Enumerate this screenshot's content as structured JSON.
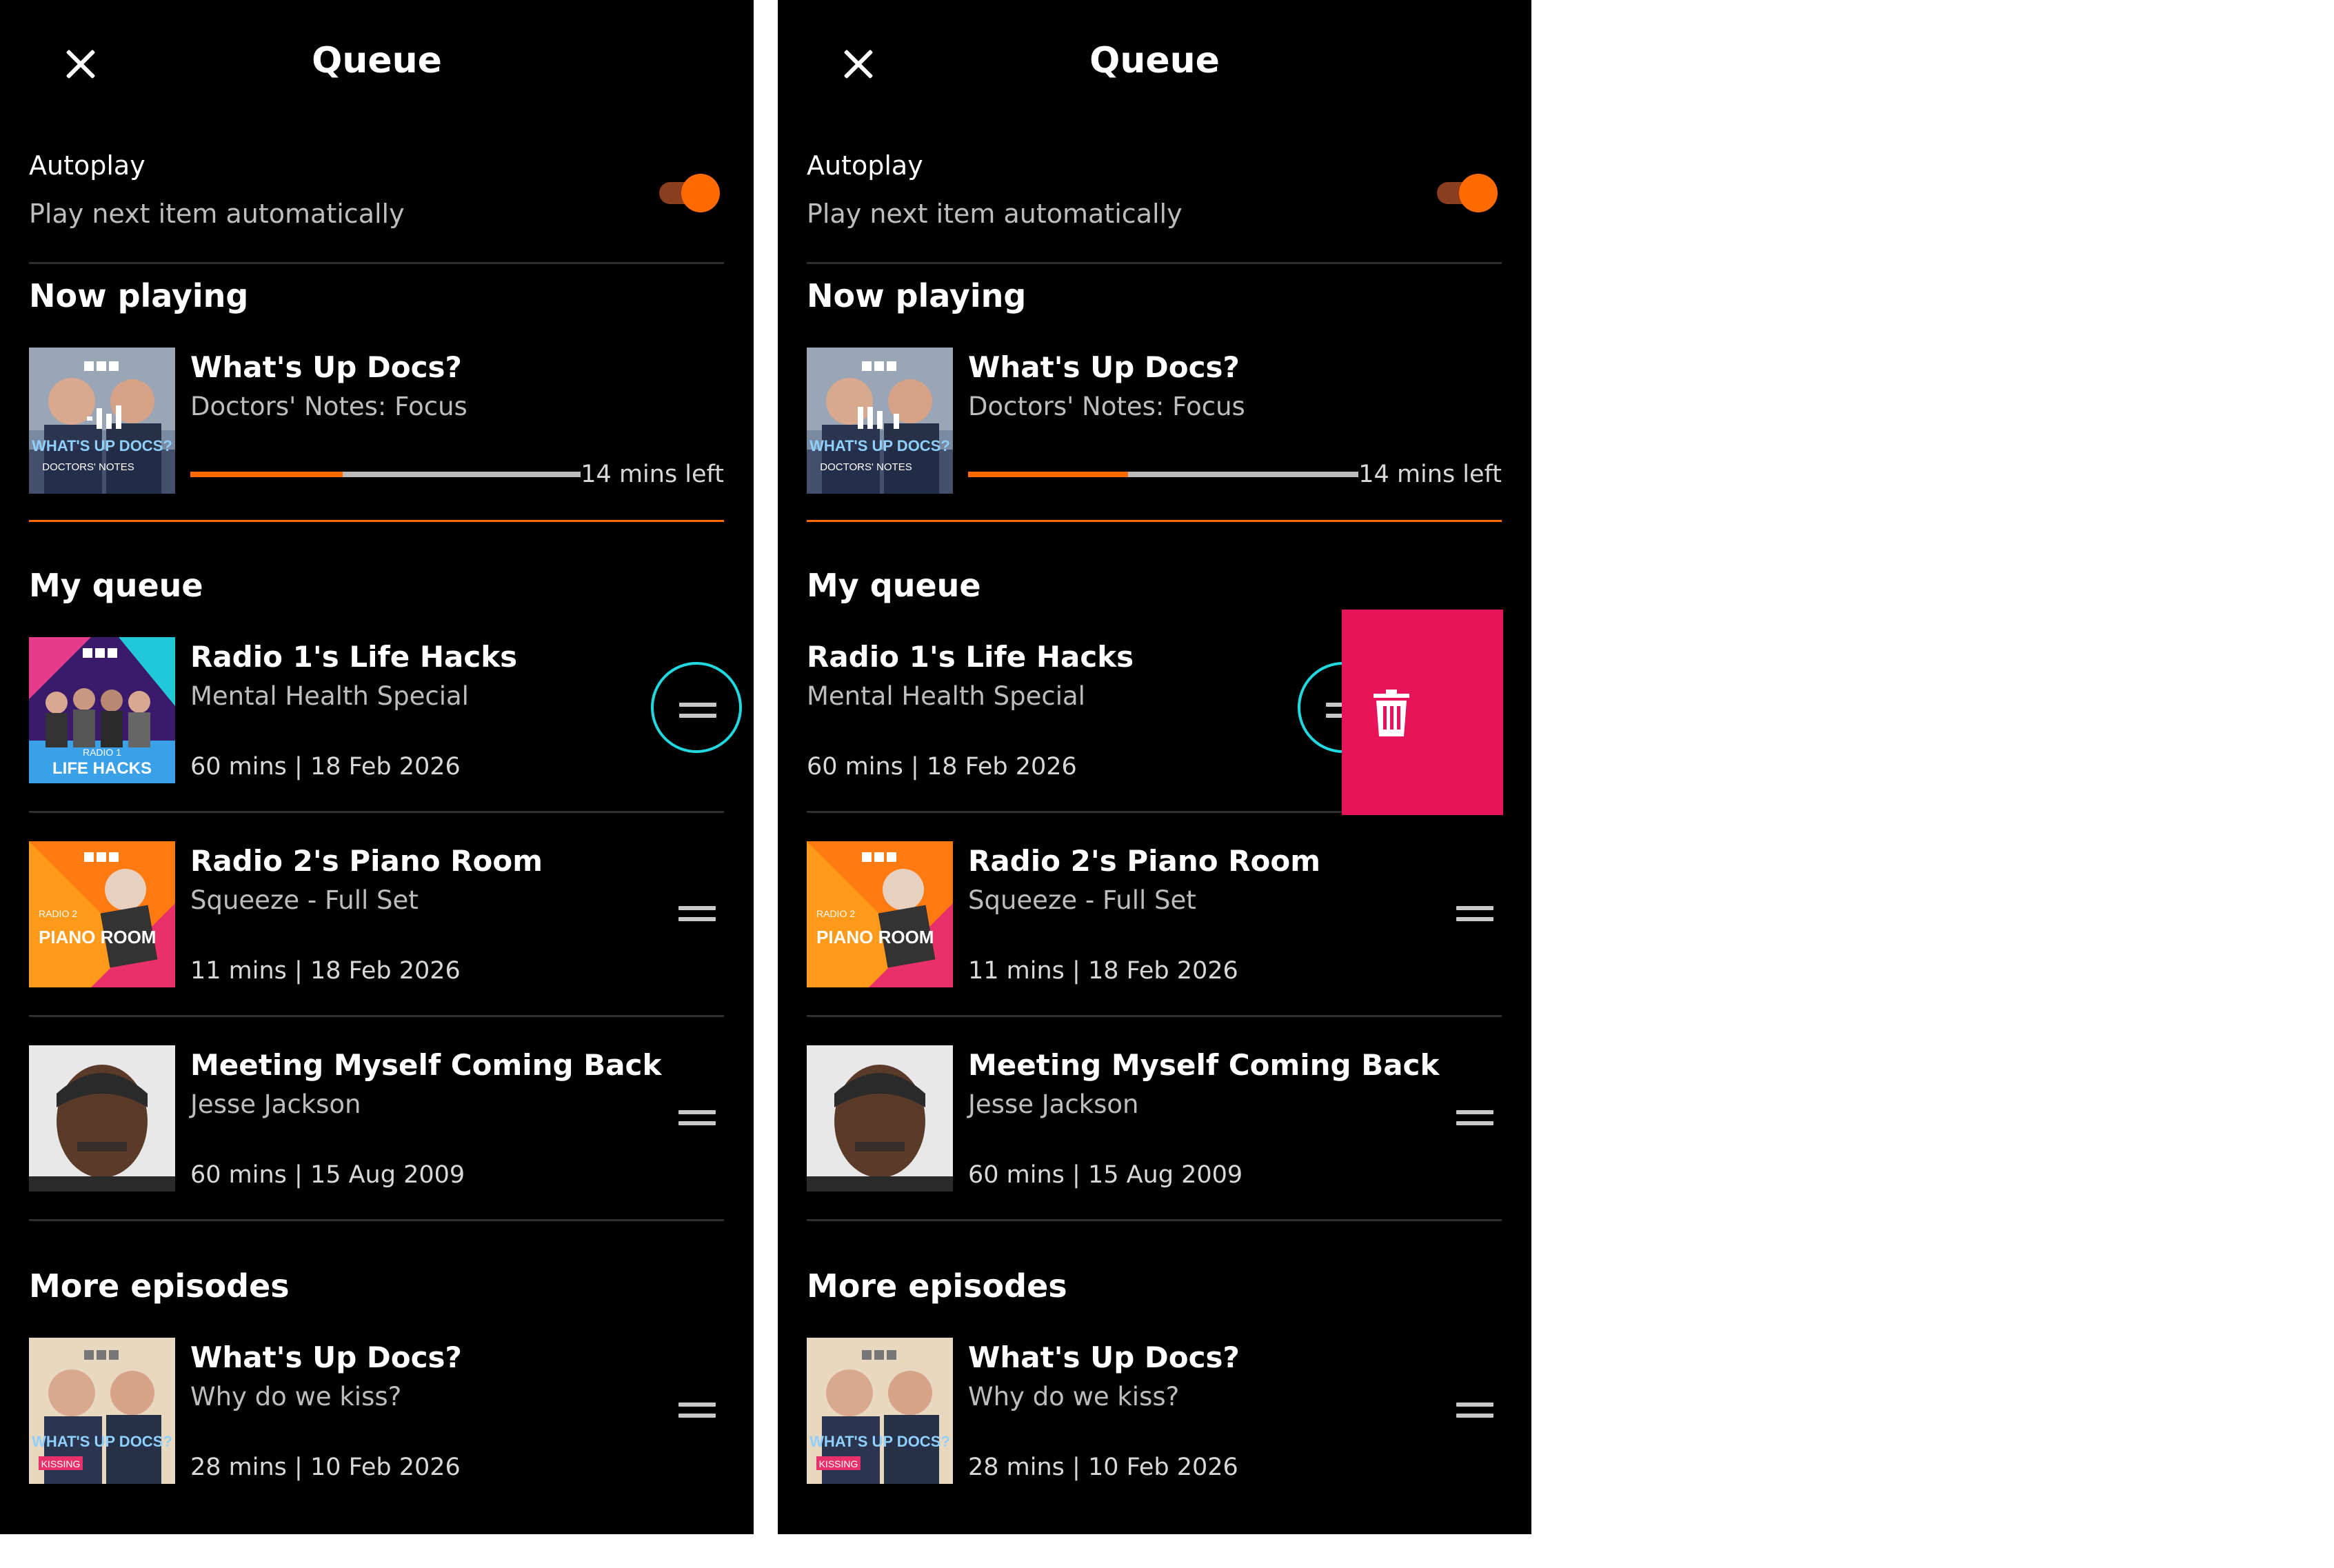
{
  "colors": {
    "accent": "#ff6a00",
    "focus_ring": "#20d8e0",
    "delete": "#e8145a",
    "background": "#000000"
  },
  "icons": {
    "close": "close-icon",
    "drag": "drag-handle-icon",
    "delete": "trash-icon",
    "playing": "equalizer-icon"
  },
  "panels": [
    {
      "title": "Queue",
      "autoplay": {
        "label": "Autoplay",
        "description": "Play next item automatically",
        "enabled": true
      },
      "now_playing": {
        "heading": "Now playing",
        "title": "What's Up Docs?",
        "subtitle": "Doctors' Notes: Focus",
        "thumb_text": "WHAT'S UP DOCS?",
        "thumb_sub": "DOCTORS' NOTES",
        "time_left": "14 mins left",
        "progress": 0.39
      },
      "my_queue": {
        "heading": "My queue",
        "items": [
          {
            "title": "Radio 1's Life Hacks",
            "subtitle": "Mental Health Special",
            "meta": "60 mins | 18 Feb 2026",
            "thumb_text": "LIFE HACKS",
            "thumb_sub": "RADIO 1"
          },
          {
            "title": "Radio 2's Piano Room",
            "subtitle": "Squeeze - Full Set",
            "meta": "11 mins | 18 Feb 2026",
            "thumb_text": "PIANO ROOM",
            "thumb_sub": "RADIO 2"
          },
          {
            "title": "Meeting Myself Coming Back",
            "subtitle": "Jesse Jackson",
            "meta": "60 mins | 15 Aug 2009"
          }
        ]
      },
      "more_episodes": {
        "heading": "More episodes",
        "items": [
          {
            "title": "What's Up Docs?",
            "subtitle": "Why do we kiss?",
            "meta": "28 mins | 10 Feb 2026",
            "thumb_text": "WHAT'S UP DOCS?",
            "thumb_sub": "KISSING"
          }
        ]
      }
    },
    {
      "title": "Queue",
      "autoplay": {
        "label": "Autoplay",
        "description": "Play next item automatically",
        "enabled": true
      },
      "now_playing": {
        "heading": "Now playing",
        "title": "What's Up Docs?",
        "subtitle": "Doctors' Notes: Focus",
        "thumb_text": "WHAT'S UP DOCS?",
        "thumb_sub": "DOCTORS' NOTES",
        "time_left": "14 mins left",
        "progress": 0.41
      },
      "my_queue": {
        "heading": "My queue",
        "items": [
          {
            "title": "Radio 1's Life Hacks",
            "subtitle": "Mental Health Special",
            "meta": "60 mins | 18 Feb 2026"
          },
          {
            "title": "Radio 2's Piano Room",
            "subtitle": "Squeeze - Full Set",
            "meta": "11 mins | 18 Feb 2026",
            "thumb_text": "PIANO ROOM",
            "thumb_sub": "RADIO 2"
          },
          {
            "title": "Meeting Myself Coming Back",
            "subtitle": "Jesse Jackson",
            "meta": "60 mins | 15 Aug 2009"
          }
        ]
      },
      "more_episodes": {
        "heading": "More episodes",
        "items": [
          {
            "title": "What's Up Docs?",
            "subtitle": "Why do we kiss?",
            "meta": "28 mins | 10 Feb 2026",
            "thumb_text": "WHAT'S UP DOCS?",
            "thumb_sub": "KISSING"
          }
        ]
      }
    }
  ]
}
